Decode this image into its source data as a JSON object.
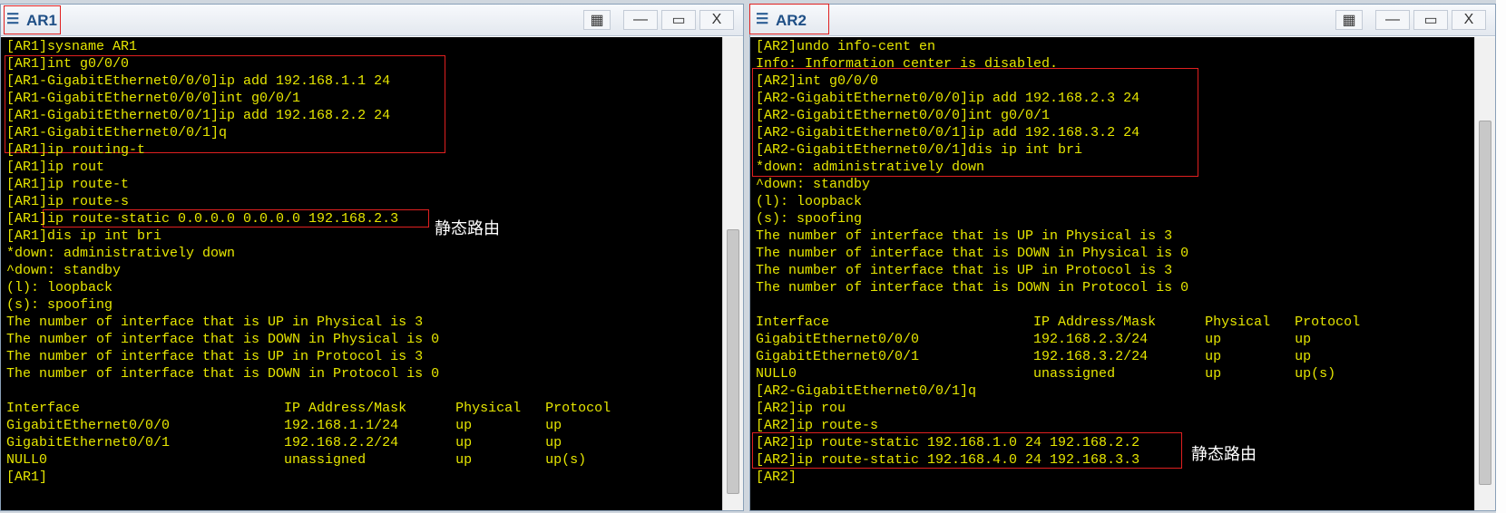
{
  "windows": {
    "ar1": {
      "title": "AR1",
      "lines": [
        "[AR1]sysname AR1",
        "[AR1]int g0/0/0",
        "[AR1-GigabitEthernet0/0/0]ip add 192.168.1.1 24",
        "[AR1-GigabitEthernet0/0/0]int g0/0/1",
        "[AR1-GigabitEthernet0/0/1]ip add 192.168.2.2 24",
        "[AR1-GigabitEthernet0/0/1]q",
        "[AR1]ip routing-t",
        "[AR1]ip rout",
        "[AR1]ip route-t",
        "[AR1]ip route-s",
        "[AR1]ip route-static 0.0.0.0 0.0.0.0 192.168.2.3",
        "[AR1]dis ip int bri",
        "*down: administratively down",
        "^down: standby",
        "(l): loopback",
        "(s): spoofing",
        "The number of interface that is UP in Physical is 3",
        "The number of interface that is DOWN in Physical is 0",
        "The number of interface that is UP in Protocol is 3",
        "The number of interface that is DOWN in Protocol is 0",
        "",
        "Interface                         IP Address/Mask      Physical   Protocol",
        "GigabitEthernet0/0/0              192.168.1.1/24       up         up",
        "GigabitEthernet0/0/1              192.168.2.2/24       up         up",
        "NULL0                             unassigned           up         up(s)",
        "[AR1]"
      ],
      "annotation": "静态路由"
    },
    "ar2": {
      "title": "AR2",
      "lines": [
        "[AR2]undo info-cent en",
        "Info: Information center is disabled.",
        "[AR2]int g0/0/0",
        "[AR2-GigabitEthernet0/0/0]ip add 192.168.2.3 24",
        "[AR2-GigabitEthernet0/0/0]int g0/0/1",
        "[AR2-GigabitEthernet0/0/1]ip add 192.168.3.2 24",
        "[AR2-GigabitEthernet0/0/1]dis ip int bri",
        "*down: administratively down",
        "^down: standby",
        "(l): loopback",
        "(s): spoofing",
        "The number of interface that is UP in Physical is 3",
        "The number of interface that is DOWN in Physical is 0",
        "The number of interface that is UP in Protocol is 3",
        "The number of interface that is DOWN in Protocol is 0",
        "",
        "Interface                         IP Address/Mask      Physical   Protocol",
        "GigabitEthernet0/0/0              192.168.2.3/24       up         up",
        "GigabitEthernet0/0/1              192.168.3.2/24       up         up",
        "NULL0                             unassigned           up         up(s)",
        "[AR2-GigabitEthernet0/0/1]q",
        "[AR2]ip rou",
        "[AR2]ip route-s",
        "[AR2]ip route-static 192.168.1.0 24 192.168.2.2",
        "[AR2]ip route-static 192.168.4.0 24 192.168.3.3",
        "[AR2]"
      ],
      "annotation": "静态路由"
    }
  },
  "window_buttons": {
    "minimize": "—",
    "maximize": "▭",
    "close": "X"
  },
  "icons": {
    "app": "router-app-icon",
    "picture": "picture-icon"
  },
  "colors": {
    "console_bg": "#000000",
    "console_text": "#e6e600",
    "highlight": "#e02020",
    "title_text": "#1f4f86"
  }
}
